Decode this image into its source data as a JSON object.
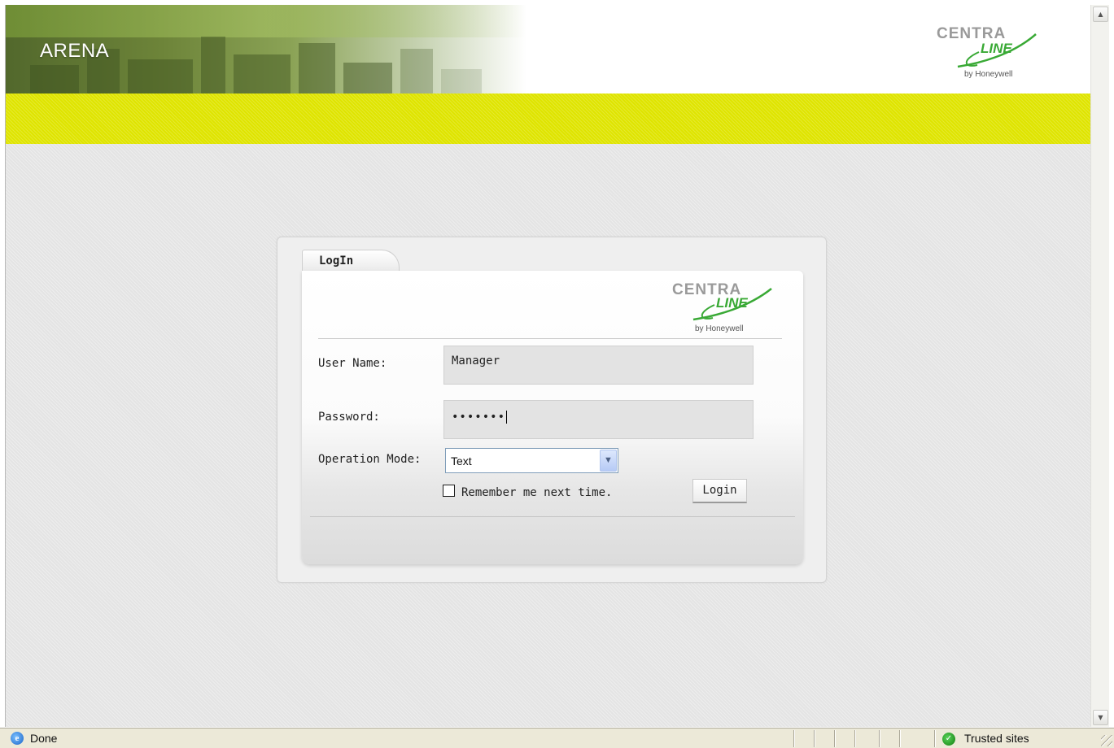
{
  "header": {
    "app_title": "ARENA",
    "logo": {
      "centra": "CENTRA",
      "line": "LINE",
      "by": "by Honeywell",
      "registered": "®"
    }
  },
  "login": {
    "tab_label": "LogIn",
    "logo": {
      "centra": "CENTRA",
      "line": "LINE",
      "by": "by Honeywell",
      "registered": "®"
    },
    "username_label": "User Name:",
    "username_value": "Manager",
    "password_label": "Password:",
    "password_value": "•••••••",
    "mode_label": "Operation Mode:",
    "mode_selected": "Text",
    "remember_label": "Remember me next time.",
    "remember_checked": false,
    "login_button": "Login"
  },
  "statusbar": {
    "status": "Done",
    "zone": "Trusted sites"
  },
  "colors": {
    "accent_yellow": "#dfe400",
    "logo_green": "#39a935",
    "logo_grey": "#9a9a9a"
  },
  "icons": {
    "status": "ie-page-icon",
    "zone": "trusted-sites-icon",
    "scroll_up": "scroll-up-arrow-icon",
    "scroll_down": "scroll-down-arrow-icon",
    "dropdown": "chevron-down-icon"
  }
}
